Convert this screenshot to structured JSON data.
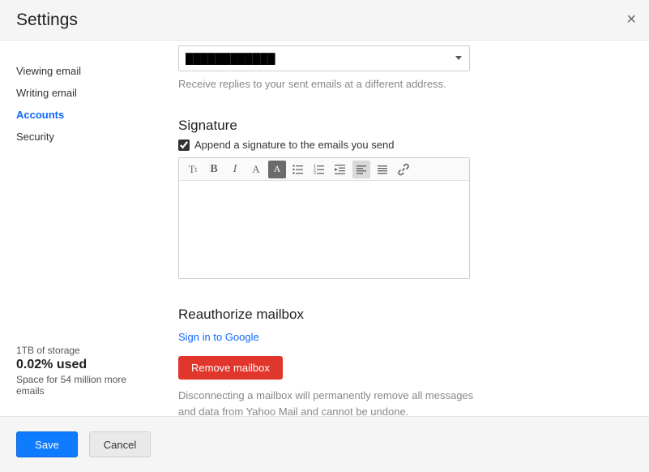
{
  "header": {
    "title": "Settings"
  },
  "sidebar": {
    "items": [
      {
        "label": "Viewing email",
        "active": false
      },
      {
        "label": "Writing email",
        "active": false
      },
      {
        "label": "Accounts",
        "active": true
      },
      {
        "label": "Security",
        "active": false
      }
    ]
  },
  "storage": {
    "total": "1TB of storage",
    "used": "0.02% used",
    "remaining": "Space for 54 million more emails"
  },
  "content": {
    "reply_to": {
      "selected": "████████████",
      "helper": "Receive replies to your sent emails at a different address."
    },
    "signature": {
      "title": "Signature",
      "append_label": "Append a signature to the emails you send",
      "append_checked": true
    },
    "reauth": {
      "title": "Reauthorize mailbox",
      "signin_label": "Sign in to Google",
      "remove_label": "Remove mailbox",
      "disconnect_text": "Disconnecting a mailbox will permanently remove all messages and data from Yahoo Mail and cannot be undone."
    }
  },
  "footer": {
    "save": "Save",
    "cancel": "Cancel"
  }
}
